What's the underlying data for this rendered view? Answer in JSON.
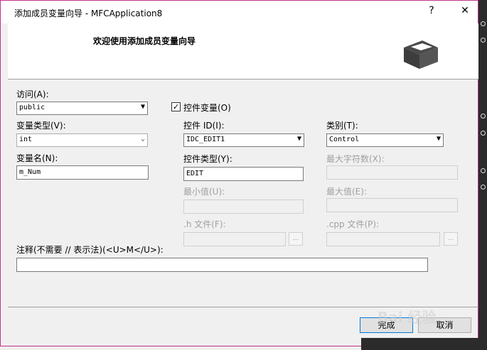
{
  "window": {
    "title": "添加成员变量向导 - MFCApplication8",
    "help_button": "?",
    "close_button": "✕"
  },
  "header": {
    "title": "欢迎使用添加成员变量向导"
  },
  "access": {
    "label": "访问(A):",
    "value": "public"
  },
  "control_variable": {
    "label": "控件变量(O)",
    "checked": true
  },
  "variable_type": {
    "label": "变量类型(V):",
    "value": "int"
  },
  "control_id": {
    "label": "控件 ID(I):",
    "value": "IDC_EDIT1"
  },
  "category": {
    "label": "类别(T):",
    "value": "Control"
  },
  "variable_name": {
    "label": "变量名(N):",
    "value": "m_Num"
  },
  "control_type": {
    "label": "控件类型(Y):",
    "value": "EDIT"
  },
  "max_chars": {
    "label": "最大字符数(X):",
    "value": ""
  },
  "min_value": {
    "label": "最小值(U):",
    "value": ""
  },
  "max_value": {
    "label": "最大值(E):",
    "value": ""
  },
  "h_file": {
    "label": ".h 文件(F):",
    "value": "",
    "browse": "..."
  },
  "cpp_file": {
    "label": ".cpp 文件(P):",
    "value": "",
    "browse": "..."
  },
  "comment": {
    "label": "注释(不需要 // 表示法)(<U>M</U>):",
    "value": ""
  },
  "buttons": {
    "finish": "完成",
    "cancel": "取消"
  },
  "watermark": "Bai 经验",
  "colors": {
    "window_border": "#c5318a",
    "default_button_border": "#0078d7"
  },
  "icons": [
    "box-icon",
    "dropdown-arrow-icon",
    "checkmark-icon"
  ]
}
